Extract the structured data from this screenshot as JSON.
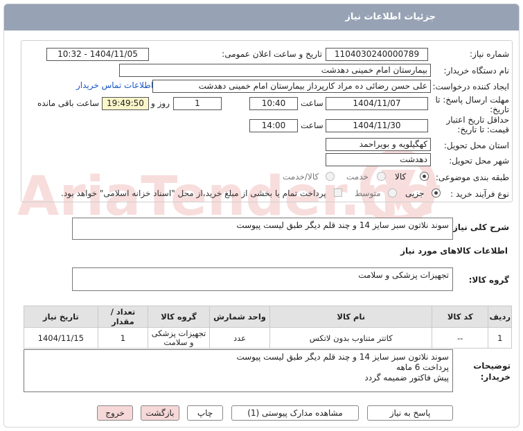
{
  "header": {
    "title": "جزئیات اطلاعات نیاز"
  },
  "labels": {
    "need_number": "شماره نیاز:",
    "announce_datetime": "تاریخ و ساعت اعلان عمومی:",
    "buyer_org": "نام دستگاه خریدار:",
    "requester": "ایجاد کننده درخواست:",
    "reply_deadline": "مهلت ارسال پاسخ: تا تاریخ:",
    "time": "ساعت",
    "and_day": "روز و",
    "remaining": "ساعت باقی مانده",
    "price_validity": "حداقل تاریخ اعتبار قیمت: تا تاریخ:",
    "delivery_province": "استان محل تحویل:",
    "delivery_city": "شهر محل تحویل:",
    "category": "طبقه بندی موضوعی:",
    "process_type": "نوع فرآیند خرید :",
    "description": "شرح کلی نیاز:",
    "goods_info": "اطلاعات کالاهای مورد نیاز",
    "goods_group": "گروه کالا:",
    "buyer_notes": "توضیحات خریدار:"
  },
  "values": {
    "need_number": "1104030240000789",
    "announce_datetime": "1404/11/05 - 10:32",
    "buyer_org": "بیمارستان امام خمینی دهدشت",
    "requester": "علی حسن رضائی ده مراد کارپرداز بیمارستان امام خمینی دهدشت",
    "contact_link": "اطلاعات تماس خریدار",
    "reply_date": "1404/11/07",
    "reply_time": "10:40",
    "days": "1",
    "remaining_time": "19:49:50",
    "price_date": "1404/11/30",
    "price_time": "14:00",
    "province": "کهگیلویه و بویراحمد",
    "city": "دهدشت",
    "description": "سوند نلاتون سبز سایز 14 و چند قلم دیگر طبق لیست پیوست",
    "goods_group": "تجهیزات پزشکی و سلامت",
    "buyer_notes_1": "سوند نلاتون سبز سایز 14 و چند قلم دیگر طبق لیست پیوست",
    "buyer_notes_2": "پرداخت 6 ماهه",
    "buyer_notes_3": "پیش فاکتور ضمیمه گردد"
  },
  "category_options": {
    "goods": "کالا",
    "service": "خدمت",
    "goods_service": "کالا/خدمت",
    "selected": "کالا"
  },
  "process_options": {
    "partial": "جزیی",
    "medium": "متوسط",
    "payment_note": "پرداخت تمام یا بخشی از مبلغ خرید،از محل \"اسناد خزانه اسلامی\" خواهد بود.",
    "selected": "جزیی"
  },
  "table": {
    "headers": [
      "ردیف",
      "کد کالا",
      "نام کالا",
      "واحد شمارش",
      "گروه کالا",
      "تعداد / مقدار",
      "تاریخ نیاز"
    ],
    "rows": [
      [
        "1",
        "--",
        "کاتتر متناوب بدون لاتکس",
        "عدد",
        "تجهیزات پزشکی و سلامت",
        "1",
        "1404/11/15"
      ]
    ]
  },
  "buttons": {
    "reply": "پاسخ به نیاز",
    "attachments": "مشاهده مدارک پیوستی (1)",
    "print": "چاپ",
    "back": "بازگشت",
    "exit": "خروج"
  },
  "watermark": {
    "text": "AriaTender.net"
  },
  "colors": {
    "titlebar": "#97a3b4",
    "link": "#1a56c4",
    "yellow_field": "#fbf6c9",
    "table_header": "#e3e3e3",
    "pink_button": "#f6d8d8"
  }
}
